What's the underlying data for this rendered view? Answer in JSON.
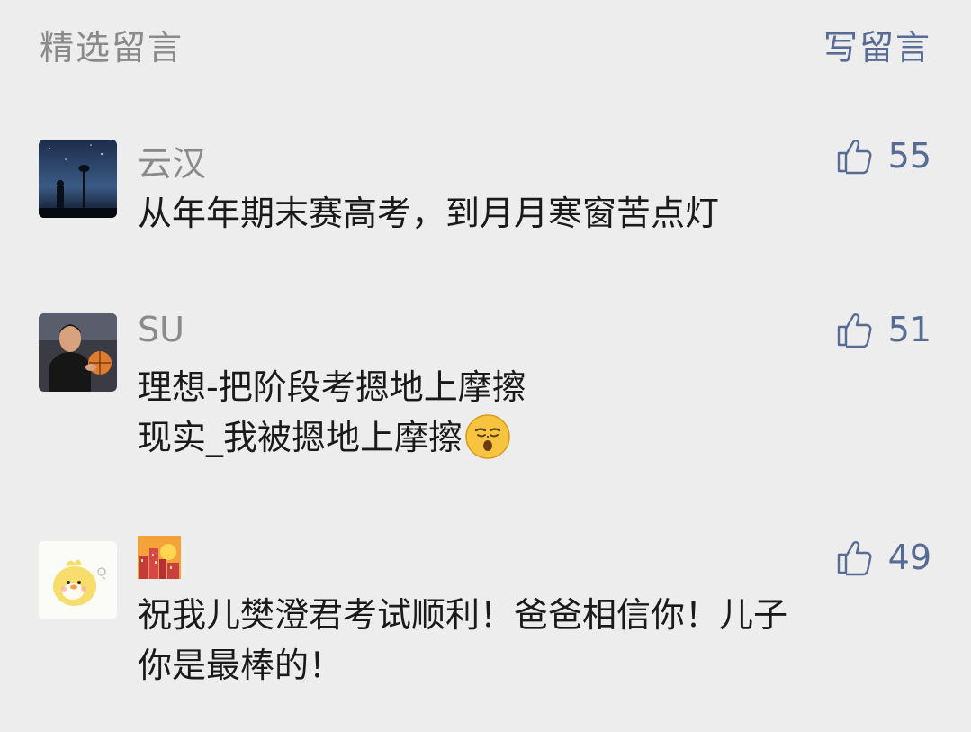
{
  "header": {
    "title": "精选留言",
    "write_label": "写留言"
  },
  "comments": [
    {
      "nickname": "云汉",
      "likes": "55",
      "lines": [
        "从年年期末赛高考，到月月寒窗苦点灯"
      ]
    },
    {
      "nickname": "SU",
      "likes": "51",
      "lines": [
        "理想-把阶段考摁地上摩擦",
        "现实_我被摁地上摩擦"
      ]
    },
    {
      "nickname": "",
      "likes": "49",
      "lines": [
        "祝我儿樊澄君考试顺利！爸爸相信你！儿子",
        "你是最棒的！"
      ]
    }
  ],
  "icons": {
    "like": "thumbs-up-icon",
    "emoji": "sleepy-face-emoji-icon",
    "nickname_emoji": "city-sunset-emoji-icon"
  },
  "colors": {
    "background": "#ededed",
    "link": "#576b95",
    "secondary_text": "#8a8a8a",
    "primary_text": "#1a1a1a"
  }
}
